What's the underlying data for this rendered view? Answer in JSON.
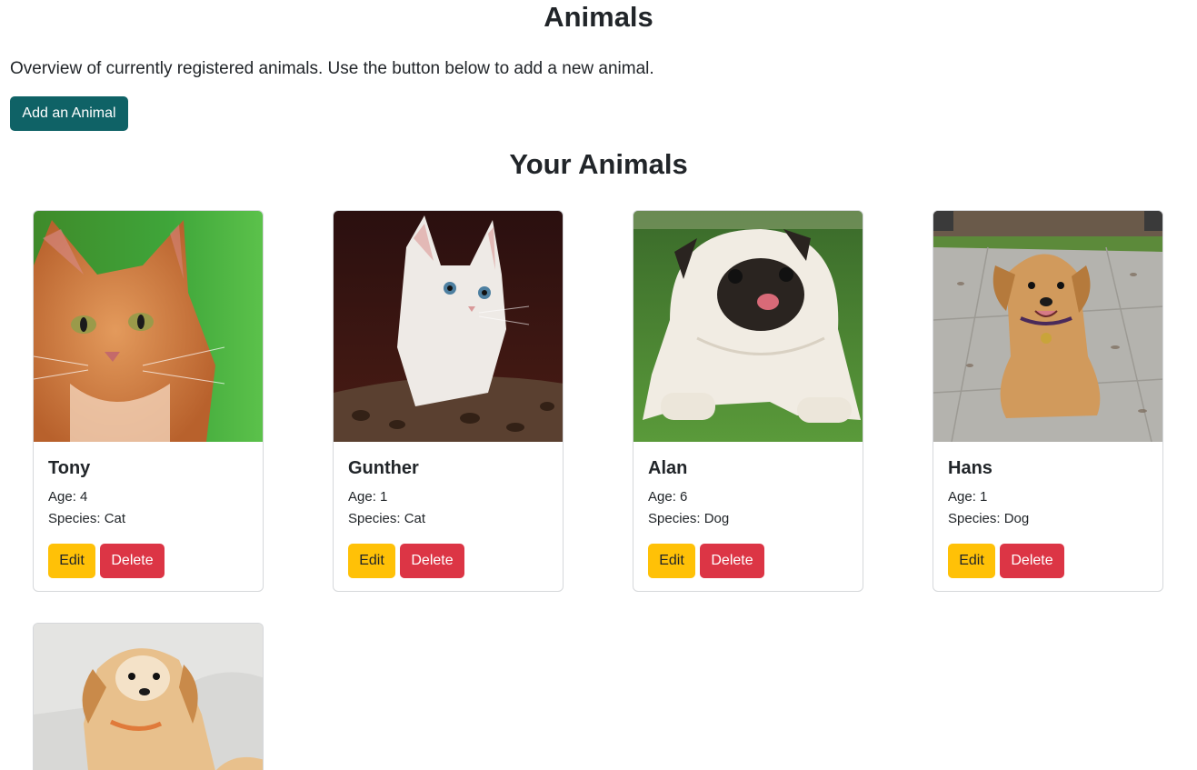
{
  "header": {
    "title": "Animals",
    "description": "Overview of currently registered animals. Use the button below to add a new animal.",
    "add_button_label": "Add an Animal"
  },
  "section": {
    "title": "Your Animals"
  },
  "labels": {
    "edit": "Edit",
    "delete": "Delete"
  },
  "animals": [
    {
      "name": "Tony",
      "age": "Age: 4",
      "species": "Species: Cat",
      "photo": "orange-tabby-cat-photo"
    },
    {
      "name": "Gunther",
      "age": "Age: 1",
      "species": "Species: Cat",
      "photo": "white-kitten-photo"
    },
    {
      "name": "Alan",
      "age": "Age: 6",
      "species": "Species: Dog",
      "photo": "pug-on-grass-photo"
    },
    {
      "name": "Hans",
      "age": "Age: 1",
      "species": "Species: Dog",
      "photo": "golden-retriever-puppy-photo"
    },
    {
      "name": "",
      "age": "",
      "species": "",
      "photo": "fluffy-puppy-photo"
    }
  ],
  "colors": {
    "primary": "#0f6266",
    "edit": "#ffc107",
    "delete": "#dc3545",
    "border": "#d6d8db"
  }
}
